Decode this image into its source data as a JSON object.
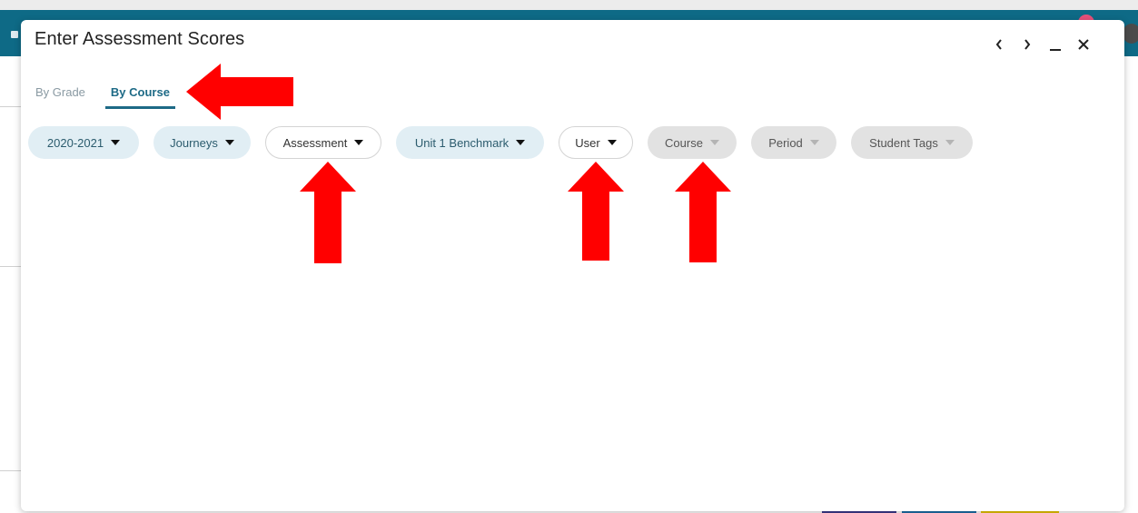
{
  "modal": {
    "title": "Enter Assessment Scores",
    "controls": {
      "prev": "‹",
      "next": "›",
      "minimize": "_",
      "close": "×"
    }
  },
  "tabs": [
    {
      "label": "By Grade",
      "active": false
    },
    {
      "label": "By Course",
      "active": true
    }
  ],
  "filters": [
    {
      "label": "2020-2021",
      "style": "light",
      "enabled": true
    },
    {
      "label": "Journeys",
      "style": "light",
      "enabled": true
    },
    {
      "label": "Assessment",
      "style": "outline",
      "enabled": true
    },
    {
      "label": "Unit 1 Benchmark",
      "style": "light",
      "enabled": true
    },
    {
      "label": "User",
      "style": "outline",
      "enabled": true
    },
    {
      "label": "Course",
      "style": "disabled",
      "enabled": false
    },
    {
      "label": "Period",
      "style": "disabled",
      "enabled": false
    },
    {
      "label": "Student Tags",
      "style": "disabled",
      "enabled": false
    }
  ],
  "colors": {
    "topbar": "#0e6a86",
    "accent": "#1d6a86",
    "annotation_arrow": "#ff0000"
  }
}
